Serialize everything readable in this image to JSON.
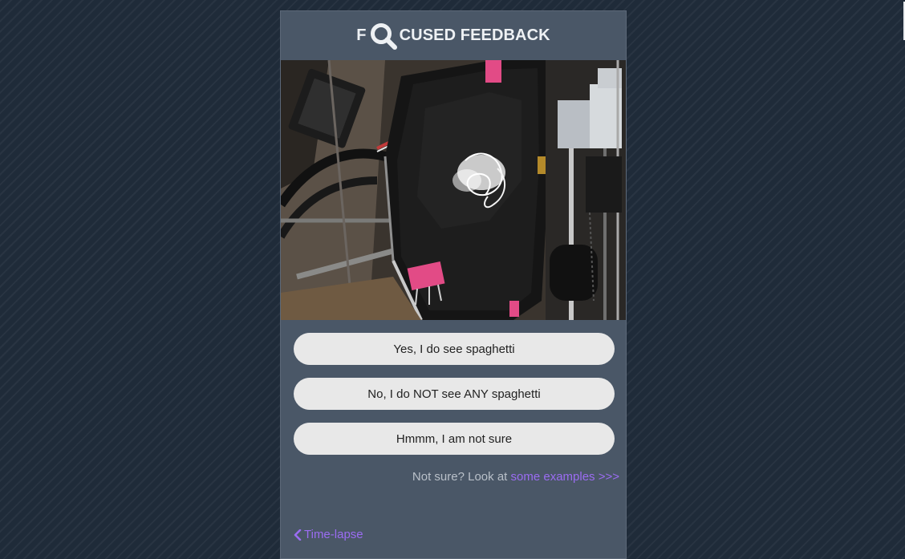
{
  "header": {
    "title_prefix": "F",
    "title_suffix": "CUSED FEEDBACK",
    "title_icon": "search-icon"
  },
  "media": {
    "subject": "3d-printer-bed-with-failed-print"
  },
  "answers": {
    "yes_label": "Yes, I do see spaghetti",
    "no_label": "No, I do NOT see ANY spaghetti",
    "unsure_label": "Hmmm, I am not sure"
  },
  "help": {
    "prompt_text": "Not sure? Look at",
    "link_text": "some examples >>>"
  },
  "navigation": {
    "back_label": "Time-lapse",
    "back_icon": "chevron-left-icon"
  },
  "colors": {
    "page_background": "#1f2b39",
    "panel_background": "#4a5767",
    "button_background": "#e8e8e8",
    "link": "#9b6cf2"
  }
}
